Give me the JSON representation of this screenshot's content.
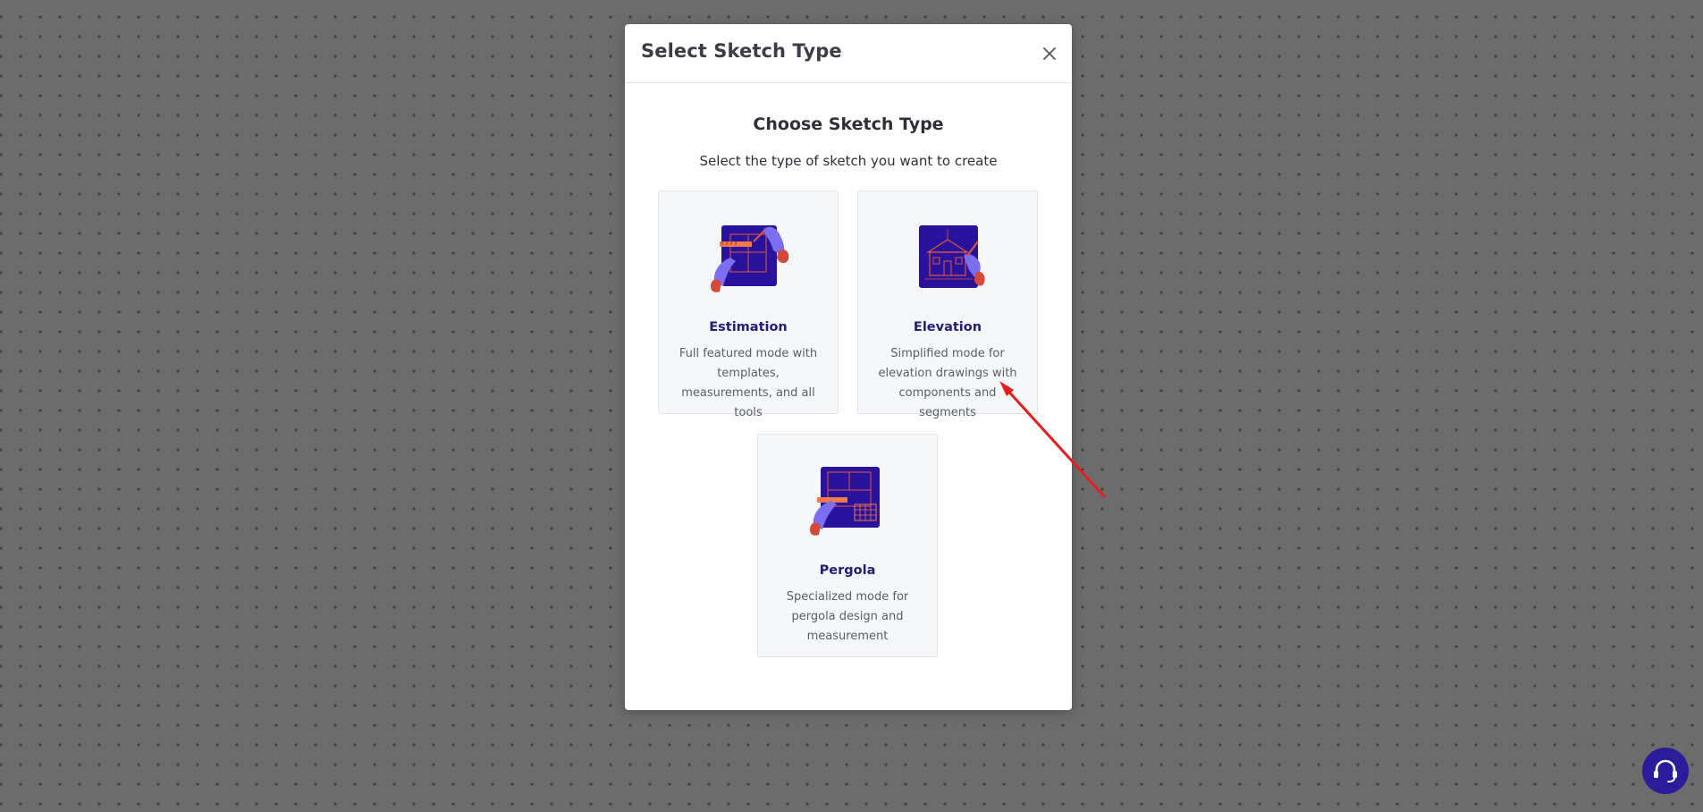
{
  "modal": {
    "title": "Select Sketch Type",
    "close_icon": "close-icon"
  },
  "content": {
    "heading": "Choose Sketch Type",
    "subheading": "Select the type of sketch you want to create"
  },
  "options": [
    {
      "title": "Estimation",
      "description": "Full featured mode with templates, measurements, and all tools",
      "icon": "estimation-illustration"
    },
    {
      "title": "Elevation",
      "description": "Simplified mode for elevation drawings with components and segments",
      "icon": "elevation-illustration"
    },
    {
      "title": "Pergola",
      "description": "Specialized mode for pergola design and measurement",
      "icon": "pergola-illustration"
    }
  ],
  "help": {
    "icon": "support-chat-icon"
  },
  "colors": {
    "overlay": "#6c6c6c",
    "card_title": "#27197a",
    "illustration_primary": "#2a139c",
    "illustration_accent": "#d44a3a",
    "annotation_arrow": "#e81c1c",
    "help_button": "#2a1c9a"
  }
}
